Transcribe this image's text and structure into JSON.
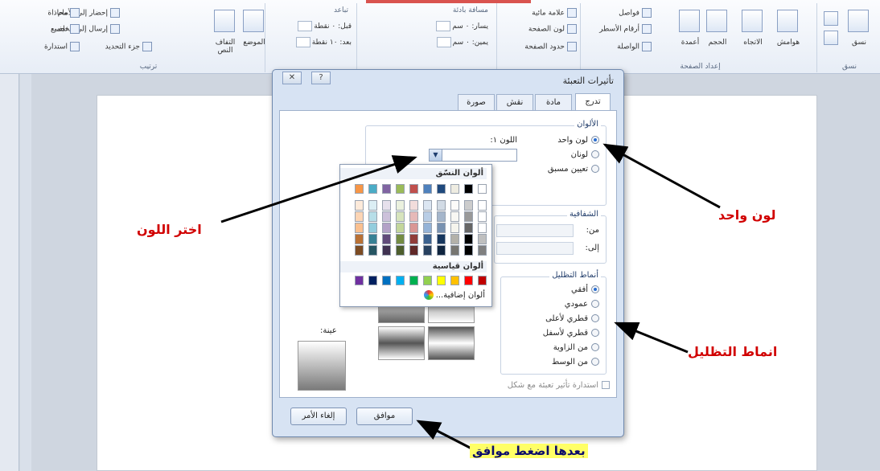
{
  "ribbon": {
    "groups": [
      {
        "caption": "ترتيب",
        "items": [
          "إحضار إلى الأمام",
          "إرسال إلى الخلف",
          "جزء التحديد",
          "محاذاة",
          "تجميع",
          "استدارة"
        ],
        "big": [
          "الموضع",
          "التفاف النص"
        ]
      },
      {
        "caption": "",
        "spacing_label": "تباعد",
        "before": "قبل: ٠ نقطة",
        "after": "بعد: ١٠ نقطة"
      },
      {
        "caption": "",
        "indent_label": "مسافة بادئة",
        "left": "يسار: ٠ سم",
        "right": "يمين: ٠ سم"
      },
      {
        "caption": "",
        "items": [
          "علامة مائية",
          "لون الصفحة",
          "حدود الصفحة"
        ]
      },
      {
        "caption": "إعداد الصفحة",
        "items": [
          "فواصل",
          "أرقام الأسطر",
          "الواصلة"
        ],
        "big": [
          "هوامش",
          "الاتجاه",
          "الحجم",
          "أعمدة"
        ]
      },
      {
        "caption": "نسق",
        "big": [
          "نسق"
        ]
      }
    ]
  },
  "dialog": {
    "title": "تأثيرات التعبئة",
    "help_glyph": "?",
    "close_glyph": "✕",
    "tabs": [
      "تدرج",
      "مادة",
      "نقش",
      "صورة"
    ],
    "colors": {
      "legend": "الألوان",
      "options": [
        "لون واحد",
        "لونان",
        "تعيين مسبق"
      ],
      "selected": 0,
      "color1_label": "اللون ١:"
    },
    "transparency": {
      "legend": "الشفافية",
      "from_label": "من:",
      "to_label": "إلى:"
    },
    "shading": {
      "legend": "أنماط التظليل",
      "options": [
        "أفقي",
        "عمودي",
        "قطري لأعلى",
        "قطري لأسفل",
        "من الزاوية",
        "من الوسط"
      ],
      "selected": 0
    },
    "sample_label": "عينة:",
    "rotate_checkbox": "استدارة تأثير تعبئة مع شكل",
    "ok": "موافق",
    "cancel": "إلغاء الأمر"
  },
  "color_picker": {
    "theme_heading": "ألوان النسّق",
    "standard_heading": "ألوان قياسية",
    "more_colors": "ألوان إضافية...",
    "theme_top": [
      "#ffffff",
      "#000000",
      "#eeece1",
      "#1f497d",
      "#4f81bd",
      "#c0504d",
      "#9bbb59",
      "#8064a2",
      "#4bacc6",
      "#f79646"
    ],
    "standard": [
      "#c00000",
      "#ff0000",
      "#ffc000",
      "#ffff00",
      "#92d050",
      "#00b050",
      "#00b0f0",
      "#0070c0",
      "#002060",
      "#7030a0"
    ]
  },
  "annotations": {
    "one_color": "لون واحد",
    "choose_color": "اختر اللون",
    "shading_styles": "انماط التظليل",
    "press_ok": "بعدها اضغط موافق"
  }
}
